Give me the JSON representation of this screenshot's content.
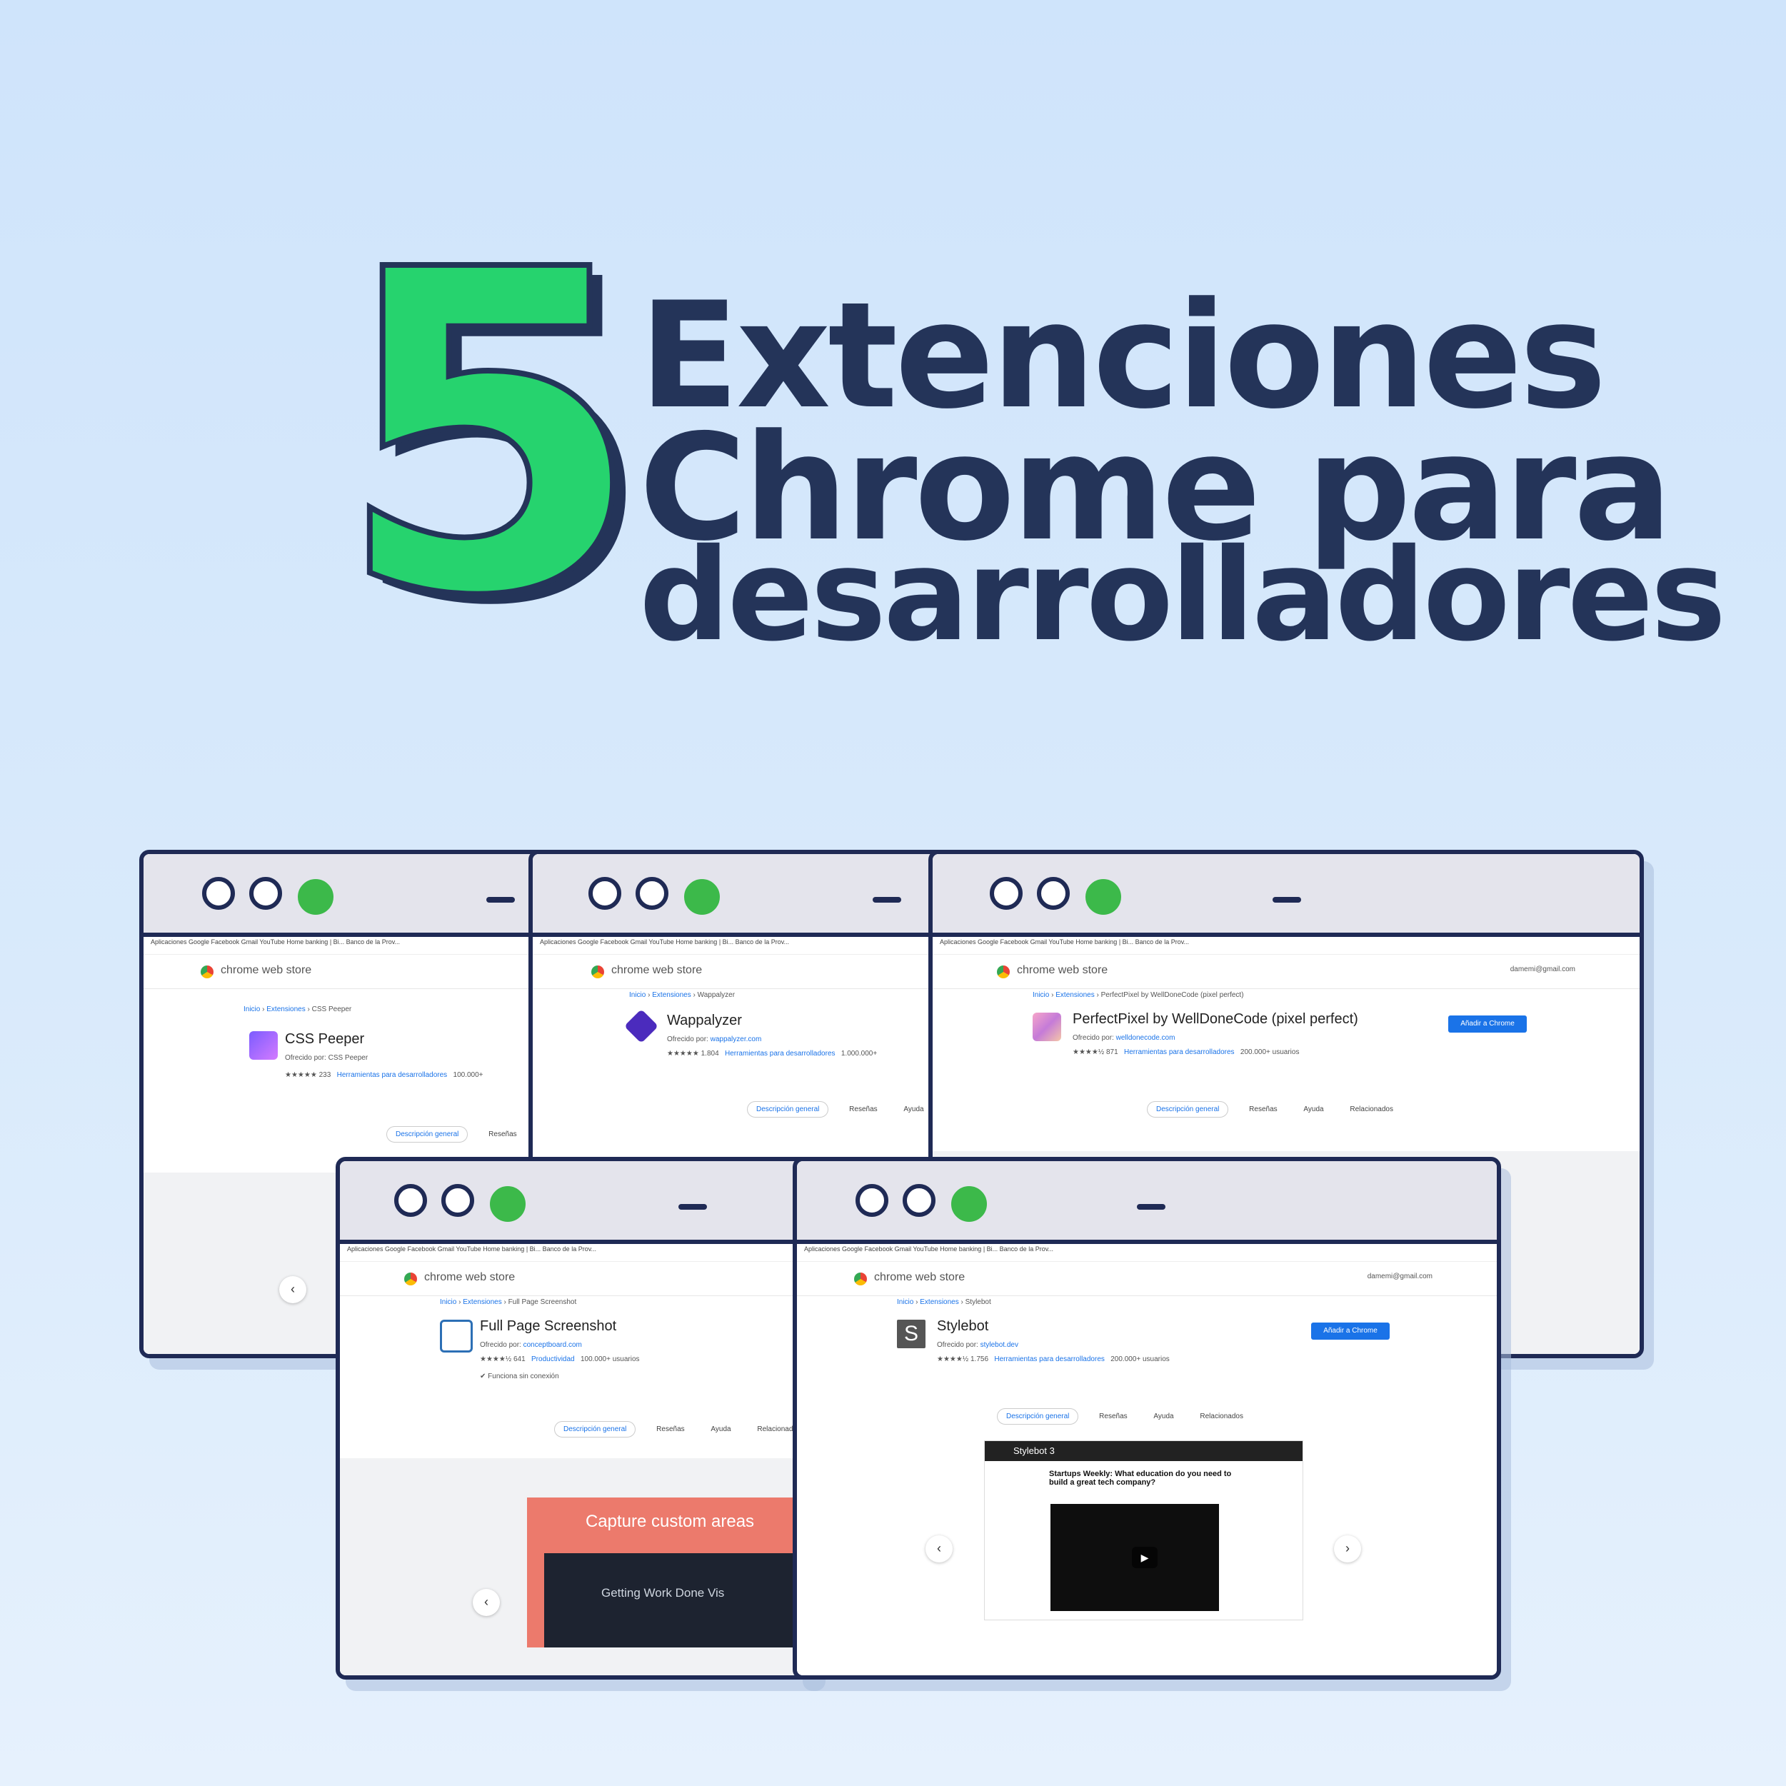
{
  "headline": {
    "number": "5",
    "line1": "Extenciones",
    "line2": "Chrome para",
    "line3": "desarrolladores"
  },
  "store": {
    "name": "chrome web store",
    "account": "damemi@gmail.com",
    "crumb_home": "Inicio",
    "crumb_section": "Extensiones",
    "offered_prefix": "Ofrecido por:",
    "add_button": "Añadir a Chrome",
    "tab_overview": "Descripción general",
    "tab_reviews": "Reseñas",
    "tab_help": "Ayuda",
    "tab_related": "Relacionados",
    "bookmarks": "Aplicaciones   Google   Facebook   Gmail   YouTube   Home banking | Bi...   Banco de la Prov..."
  },
  "windows": [
    {
      "name": "CSS Peeper",
      "offered_by": "CSS Peeper",
      "rating": "★★★★★ 233",
      "category": "Herramientas para desarrolladores",
      "users": "100.000+"
    },
    {
      "name": "Wappalyzer",
      "offered_by": "wappalyzer.com",
      "rating": "★★★★★ 1.804",
      "category": "Herramientas para desarrolladores",
      "users": "1.000.000+"
    },
    {
      "name": "PerfectPixel by WellDoneCode (pixel perfect)",
      "offered_by": "welldonecode.com",
      "rating": "★★★★½ 871",
      "category": "Herramientas para desarrolladores",
      "users": "200.000+ usuarios"
    },
    {
      "name": "Full Page Screenshot",
      "offered_by": "conceptboard.com",
      "rating": "★★★★½ 641",
      "category": "Productividad",
      "users": "100.000+ usuarios",
      "offline": "Funciona sin conexión",
      "shot_caption": "Capture custom areas",
      "shot_sub": "Getting Work Done Vis"
    },
    {
      "name": "Stylebot",
      "offered_by": "stylebot.dev",
      "rating": "★★★★½ 1.756",
      "category": "Herramientas para desarrolladores",
      "users": "200.000+ usuarios",
      "video_title": "Stylebot 3",
      "video_headline": "Startups Weekly: What education do you need to build a great tech company?"
    }
  ],
  "colors": {
    "background": "#d3e6fb",
    "five": "#26d36e",
    "navy": "#243459",
    "green_dot": "#3cb94a",
    "link": "#1a73e8"
  }
}
